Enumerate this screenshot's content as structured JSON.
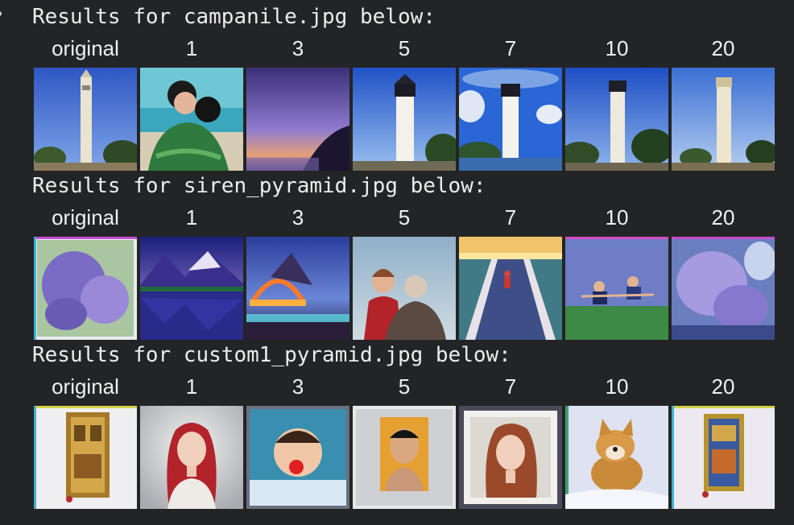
{
  "sections": [
    {
      "heading": "Results for campanile.jpg below:",
      "labels": [
        "original",
        "1",
        "3",
        "5",
        "7",
        "10",
        "20"
      ],
      "images": [
        "campanile-tower-photo",
        "couple-embracing-by-sea",
        "purple-sunset-coastline",
        "white-lighthouse",
        "lighthouse-with-clouds",
        "lighthouse-with-trees",
        "lighthouse-pale-sky"
      ]
    },
    {
      "heading": "Results for siren_pyramid.jpg below:",
      "labels": [
        "original",
        "1",
        "3",
        "5",
        "7",
        "10",
        "20"
      ],
      "images": [
        "lilac-flowers-framed",
        "mountain-lake-reflection",
        "glowing-bridge-at-dusk",
        "woman-and-old-man",
        "pier-walkway-over-water",
        "people-floating-over-lake",
        "lilac-flowers-by-water"
      ]
    },
    {
      "heading": "Results for custom1_pyramid.jpg below:",
      "labels": [
        "original",
        "1",
        "3",
        "5",
        "7",
        "10",
        "20"
      ],
      "images": [
        "ornate-golden-book",
        "red-haired-woman-portrait",
        "baby-with-red-nose",
        "framed-portrait-man",
        "framed-portrait-woman",
        "shiba-dog-in-snow",
        "ornate-tapestry-book"
      ]
    }
  ]
}
